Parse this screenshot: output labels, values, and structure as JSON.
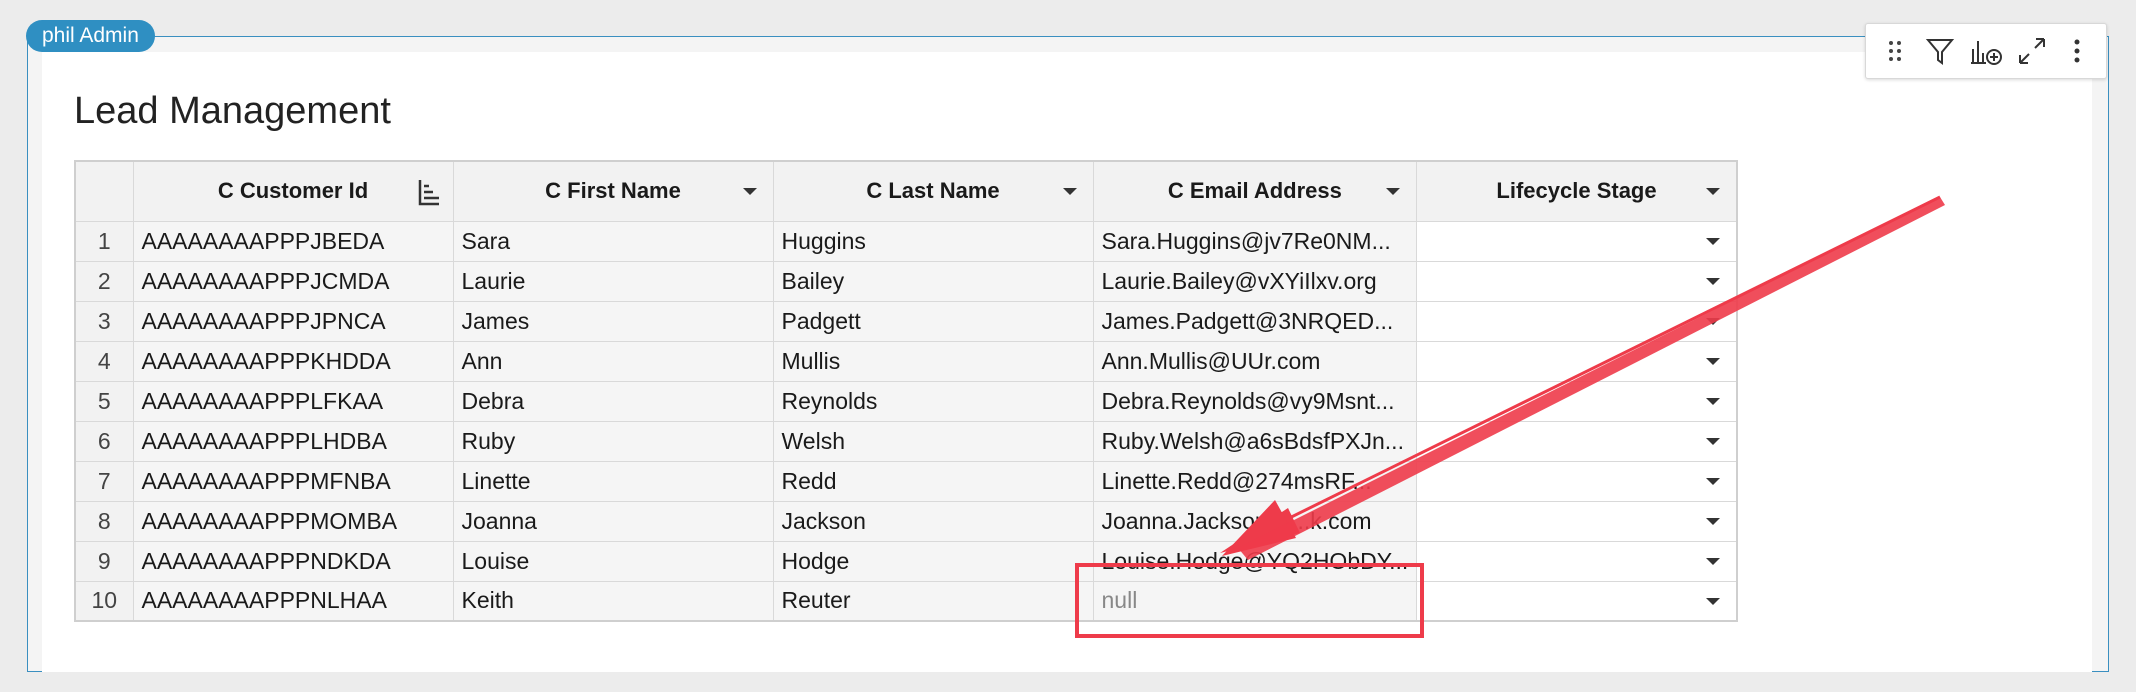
{
  "user_badge": "phil Admin",
  "page_title": "Lead Management",
  "toolbar": {
    "icons": [
      "drag-handle-icon",
      "filter-icon",
      "add-chart-icon",
      "expand-icon",
      "more-vertical-icon"
    ]
  },
  "table": {
    "columns": [
      "C Customer Id",
      "C First Name",
      "C Last Name",
      "C Email Address",
      "Lifecycle Stage"
    ],
    "rows": [
      {
        "num": "1",
        "id": "AAAAAAAAPPPJBEDA",
        "first": "Sara",
        "last": "Huggins",
        "email": "Sara.Huggins@jv7Re0NM...",
        "stage": ""
      },
      {
        "num": "2",
        "id": "AAAAAAAAPPPJCMDA",
        "first": "Laurie",
        "last": "Bailey",
        "email": "Laurie.Bailey@vXYiIlxv.org",
        "stage": ""
      },
      {
        "num": "3",
        "id": "AAAAAAAAPPPJPNCA",
        "first": "James",
        "last": "Padgett",
        "email": "James.Padgett@3NRQED...",
        "stage": ""
      },
      {
        "num": "4",
        "id": "AAAAAAAAPPPKHDDA",
        "first": "Ann",
        "last": "Mullis",
        "email": "Ann.Mullis@UUr.com",
        "stage": ""
      },
      {
        "num": "5",
        "id": "AAAAAAAAPPPLFKAA",
        "first": "Debra",
        "last": "Reynolds",
        "email": "Debra.Reynolds@vy9Msnt...",
        "stage": ""
      },
      {
        "num": "6",
        "id": "AAAAAAAAPPPLHDBA",
        "first": "Ruby",
        "last": "Welsh",
        "email": "Ruby.Welsh@a6sBdsfPXJn...",
        "stage": ""
      },
      {
        "num": "7",
        "id": "AAAAAAAAPPPMFNBA",
        "first": "Linette",
        "last": "Redd",
        "email": "Linette.Redd@274msRF...",
        "stage": ""
      },
      {
        "num": "8",
        "id": "AAAAAAAAPPPMOMBA",
        "first": "Joanna",
        "last": "Jackson",
        "email": "Joanna.Jackson@...k.com",
        "stage": ""
      },
      {
        "num": "9",
        "id": "AAAAAAAAPPPNDKDA",
        "first": "Louise",
        "last": "Hodge",
        "email": "Louise.Hodge@YQ2HObDY...",
        "stage": ""
      },
      {
        "num": "10",
        "id": "AAAAAAAAPPPNLHAA",
        "first": "Keith",
        "last": "Reuter",
        "email": "null",
        "stage": ""
      }
    ]
  },
  "colors": {
    "accent": "#2f8fc2",
    "annotation": "#ee3b4a"
  }
}
